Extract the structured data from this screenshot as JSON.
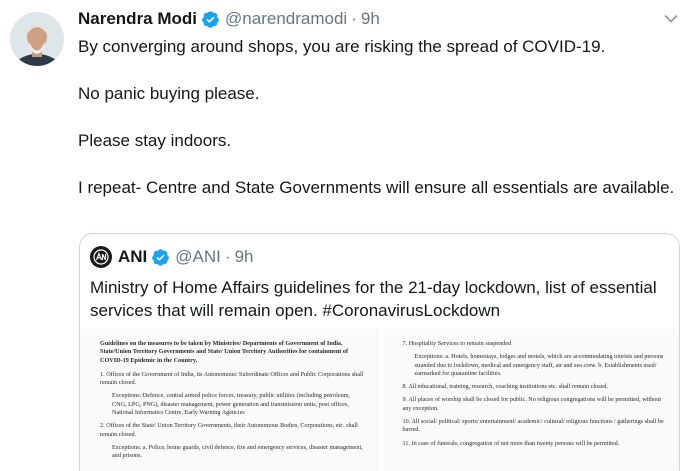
{
  "tweet": {
    "author_name": "Narendra Modi",
    "handle": "@narendramodi",
    "separator": "·",
    "time": "9h",
    "avatar_icon": "person-avatar",
    "paragraphs": [
      "By converging around shops, you are risking the spread of COVID-19.",
      "No panic buying please.",
      "Please stay indoors.",
      "I repeat- Centre and State Governments will ensure all essentials are available."
    ]
  },
  "quoted": {
    "author_name": "ANI",
    "handle": "@ANI",
    "separator": "·",
    "time": "9h",
    "text": "Ministry of Home Affairs guidelines for the 21-day lockdown, list of essential services that will remain open. #CoronavirusLockdown",
    "doc_left": {
      "heading": "Guidelines on the measures to be taken by Ministries/ Departments of Government of India, State/Union Territory Governments and State/ Union Territory Authorities for containment of COVID-19 Epidemic in the Country.",
      "item1": "1. Offices of the Government of India, its Autonomous/ Subordinate Offices and Public Corporations shall remain closed.",
      "item1_sub": "Exceptions: Defence, central armed police forces, treasury, public utilities (including petroleum, CNG, LPG, PNG), disaster management, power generation and transmission units, post offices, National Informatics Centre, Early Warning Agencies",
      "item2": "2. Offices of the State/ Union Territory Governments, their Autonomous Bodies, Corporations, etc. shall remain closed.",
      "item2_sub": "Exceptions: a. Police, home guards, civil defence, fire and emergency services, disaster management, and prisons."
    },
    "doc_right": {
      "item7": "7. Hospitality Services to remain suspended",
      "item7_sub": "Exceptions: a. Hotels, homestays, lodges and motels, which are accommodating tourists and persons stranded due to lockdown, medical and emergency staff, air and sea crew. b. Establishments used/ earmarked for quarantine facilities.",
      "item8": "8. All educational, training, research, coaching institutions etc. shall remain closed.",
      "item9": "9. All places of worship shall be closed for public. No religious congregations will be permitted, without any exception.",
      "item10": "10. All social/ political/ sports/ entertainment/ academic/ cultural/ religious functions / gatherings shall be barred.",
      "item11": "11. In case of funerals, congregation of not more than twenty persons will be permitted."
    }
  },
  "colors": {
    "verified": "#1da1f2",
    "muted": "#657786",
    "border": "#ccd6dd"
  }
}
